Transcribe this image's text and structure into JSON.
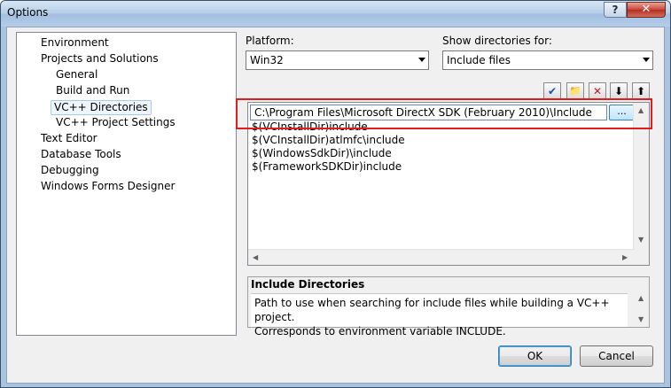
{
  "window": {
    "title": "Options",
    "help_glyph": "?",
    "close_glyph": "✕"
  },
  "tree": {
    "items": [
      {
        "label": "Environment",
        "level": 0
      },
      {
        "label": "Projects and Solutions",
        "level": 0
      },
      {
        "label": "General",
        "level": 1
      },
      {
        "label": "Build and Run",
        "level": 1
      },
      {
        "label": "VC++ Directories",
        "level": 1,
        "selected": true
      },
      {
        "label": "VC++ Project Settings",
        "level": 1
      },
      {
        "label": "Text Editor",
        "level": 0
      },
      {
        "label": "Database Tools",
        "level": 0
      },
      {
        "label": "Debugging",
        "level": 0
      },
      {
        "label": "Windows Forms Designer",
        "level": 0
      }
    ]
  },
  "platform": {
    "label": "Platform:",
    "value": "Win32"
  },
  "show_dirs": {
    "label": "Show directories for:",
    "value": "Include files"
  },
  "toolbar": {
    "check_glyph": "✔",
    "new_folder_glyph": "📁",
    "delete_glyph": "✕",
    "down_glyph": "⬇",
    "up_glyph": "⬆"
  },
  "directories": {
    "editing_value": "C:\\Program Files\\Microsoft DirectX SDK (February 2010)\\Include",
    "browse_label": "...",
    "rows": [
      "$(VCInstallDir)include",
      "$(VCInstallDir)atlmfc\\include",
      "$(WindowsSdkDir)\\include",
      "$(FrameworkSDKDir)include"
    ]
  },
  "description": {
    "title": "Include Directories",
    "line1": "Path to use when searching for include files while building a VC++ project.",
    "line2": "Corresponds to environment variable INCLUDE."
  },
  "buttons": {
    "ok": "OK",
    "cancel": "Cancel"
  },
  "colors": {
    "highlight": "#e01d1d",
    "accent": "#3c7fb1"
  }
}
